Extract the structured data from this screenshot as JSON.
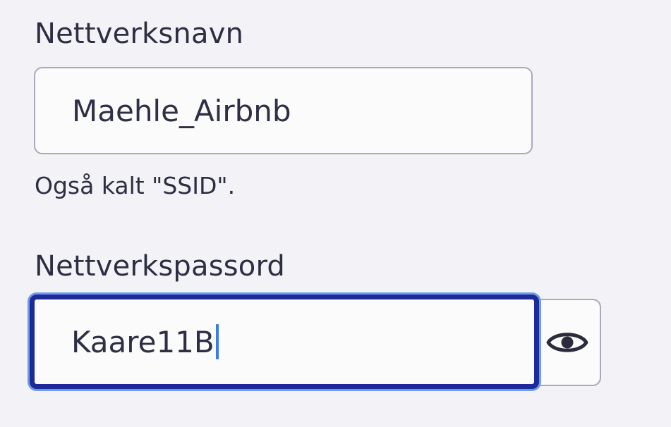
{
  "ssid": {
    "label": "Nettverksnavn",
    "value": "Maehle_Airbnb",
    "helper": "Også kalt \"SSID\"."
  },
  "password": {
    "label": "Nettverkspassord",
    "value": "Kaare11B",
    "toggle_icon": "eye-icon",
    "focused": true
  },
  "colors": {
    "background": "#f2f2f7",
    "focus_border": "#1f2a99",
    "focus_ring": "#6f9be8",
    "input_border": "#a9a9bd",
    "text": "#2e2e42",
    "caret": "#3b7ee0"
  }
}
